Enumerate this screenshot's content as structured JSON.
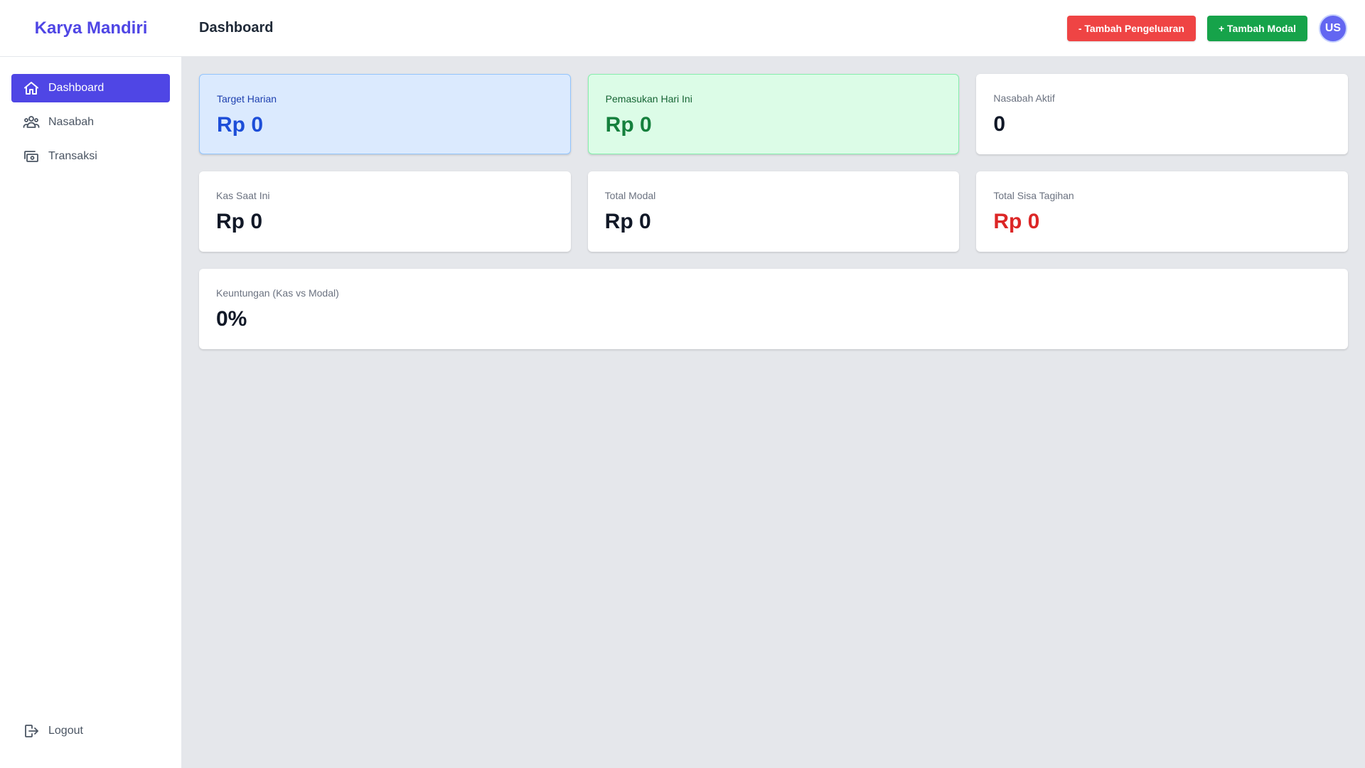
{
  "app": {
    "brand": "Karya Mandiri"
  },
  "header": {
    "title": "Dashboard",
    "expense_button": "- Tambah Pengeluaran",
    "capital_button": "+ Tambah Modal",
    "avatar_initials": "US"
  },
  "sidebar": {
    "items": [
      {
        "label": "Dashboard",
        "icon": "home-icon",
        "active": true
      },
      {
        "label": "Nasabah",
        "icon": "users-icon",
        "active": false
      },
      {
        "label": "Transaksi",
        "icon": "cash-icon",
        "active": false
      }
    ],
    "logout_label": "Logout"
  },
  "stats": {
    "target_harian": {
      "label": "Target Harian",
      "value": "Rp 0"
    },
    "pemasukan": {
      "label": "Pemasukan Hari Ini",
      "value": "Rp 0"
    },
    "nasabah_aktif": {
      "label": "Nasabah Aktif",
      "value": "0"
    },
    "kas": {
      "label": "Kas Saat Ini",
      "value": "Rp 0"
    },
    "total_modal": {
      "label": "Total Modal",
      "value": "Rp 0"
    },
    "sisa_tagihan": {
      "label": "Total Sisa Tagihan",
      "value": "Rp 0"
    },
    "keuntungan": {
      "label": "Keuntungan (Kas vs Modal)",
      "value": "0%"
    }
  },
  "colors": {
    "accent": "#4f46e5",
    "danger": "#ef4444",
    "success": "#16a34a"
  }
}
